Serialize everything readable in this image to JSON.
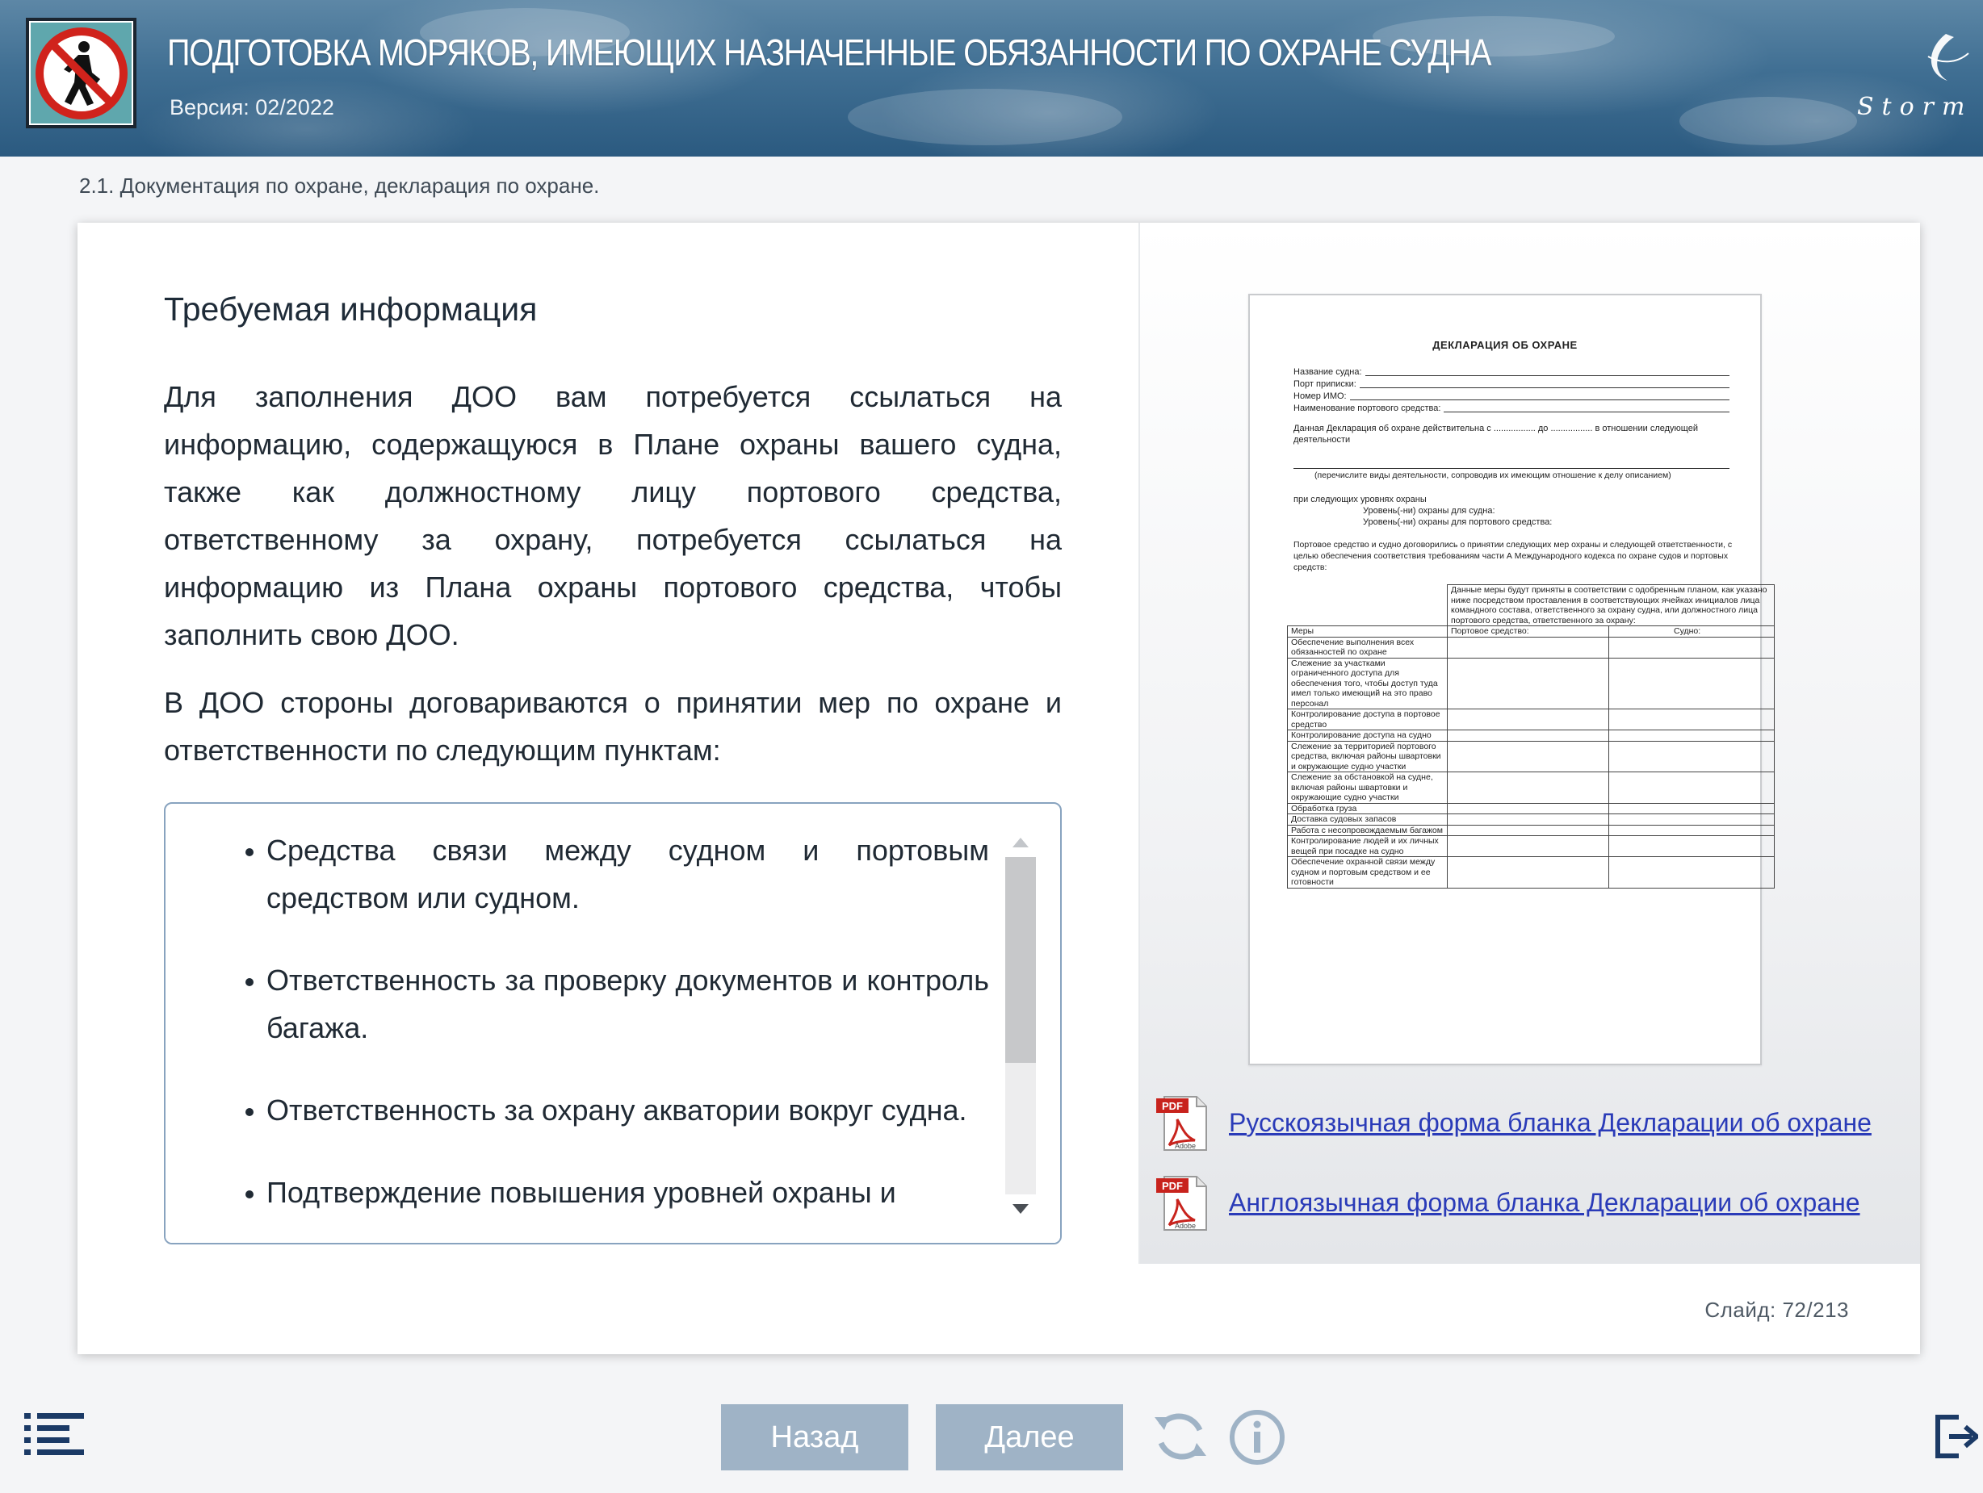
{
  "header": {
    "title": "ПОДГОТОВКА МОРЯКОВ, ИМЕЮЩИХ НАЗНАЧЕННЫЕ ОБЯЗАННОСТИ ПО ОХРАНЕ СУДНА",
    "version": "Версия: 02/2022",
    "brand_logo_text": "Storm"
  },
  "breadcrumb": "2.1. Документация по охране, декларация по охране.",
  "content": {
    "section_title": "Требуемая информация",
    "paragraph1": "Для заполнения ДОО вам потребуется ссылаться на информацию, содержащуюся в Плане охраны вашего судна, также как должностному лицу портового средства, ответственному за охрану, потребуется ссылаться на информацию из Плана охраны портового средства, чтобы заполнить свою ДОО.",
    "paragraph2": "В ДОО стороны договариваются о принятии мер по охране и ответственности по следующим пунктам:",
    "list_items": [
      "Средства связи между судном и портовым средством или судном.",
      "Ответственность за проверку документов и контроль багажа.",
      "Ответственность за охрану акватории вокруг судна.",
      "Подтверждение повышения уровней охраны и"
    ]
  },
  "document_preview": {
    "title": "ДЕКЛАРАЦИЯ ОБ ОХРАНЕ",
    "fields": [
      "Название судна:",
      "Порт приписки:",
      "Номер ИМО:",
      "Наименование портового средства:"
    ],
    "validity_text": "Данная Декларация об охране действительна с ................. до ................. в отношении следующей деятельности",
    "activities_hint": "(перечислите виды деятельности, сопроводив их имеющим отношение к делу описанием)",
    "levels_intro": "при следующих уровнях охраны",
    "level_ship": "Уровень(-ни) охраны для судна:",
    "level_port": "Уровень(-ни) охраны для портового средства:",
    "agreement_text": "Портовое средство и судно договорились о принятии следующих мер охраны и следующей ответственности, с целью обеспечения соответствия требованиям части А Международного кодекса по охране судов и портовых средств:",
    "table_header_note": "Данные меры будут приняты в соответствии с одобренным планом, как указано ниже посредством проставления в соответствующих ячейках инициалов лица командного состава, ответственного за охрану судна, или должностного лица портового средства, ответственного за охрану:",
    "col_measures": "Меры",
    "col_port": "Портовое средство:",
    "col_ship": "Судно:",
    "rows": [
      "Обеспечение выполнения всех обязанностей по охране",
      "Слежение за участками ограниченного доступа для обеспечения того, чтобы доступ туда имел только имеющий на это право персонал",
      "Контролирование доступа в портовое средство",
      "Контролирование доступа на судно",
      "Слежение за территорией портового средства, включая районы швартовки и окружающие судно участки",
      "Слежение за обстановкой на судне, включая районы швартовки и окружающие судно участки",
      "Обработка груза",
      "Доставка судовых запасов",
      "Работа с несопровождаемым багажом",
      "Контролирование людей и их личных вещей при посадке на судно",
      "Обеспечение охранной связи между судном и портовым средством и ее готовности"
    ]
  },
  "links": {
    "pdf_ru": "Русскоязычная форма бланка Декларации об охране",
    "pdf_en": "Англоязычная форма бланка Декларации об охране",
    "pdf_badge": "PDF",
    "pdf_brand": "Adobe"
  },
  "slide_counter": "Слайд:  72/213",
  "navigation": {
    "back": "Назад",
    "next": "Далее"
  },
  "colors": {
    "nav_button_bg": "#9fb3c6",
    "link": "#2a3bb8",
    "list_border": "#88a3bf",
    "icon": "#1b3a66"
  }
}
